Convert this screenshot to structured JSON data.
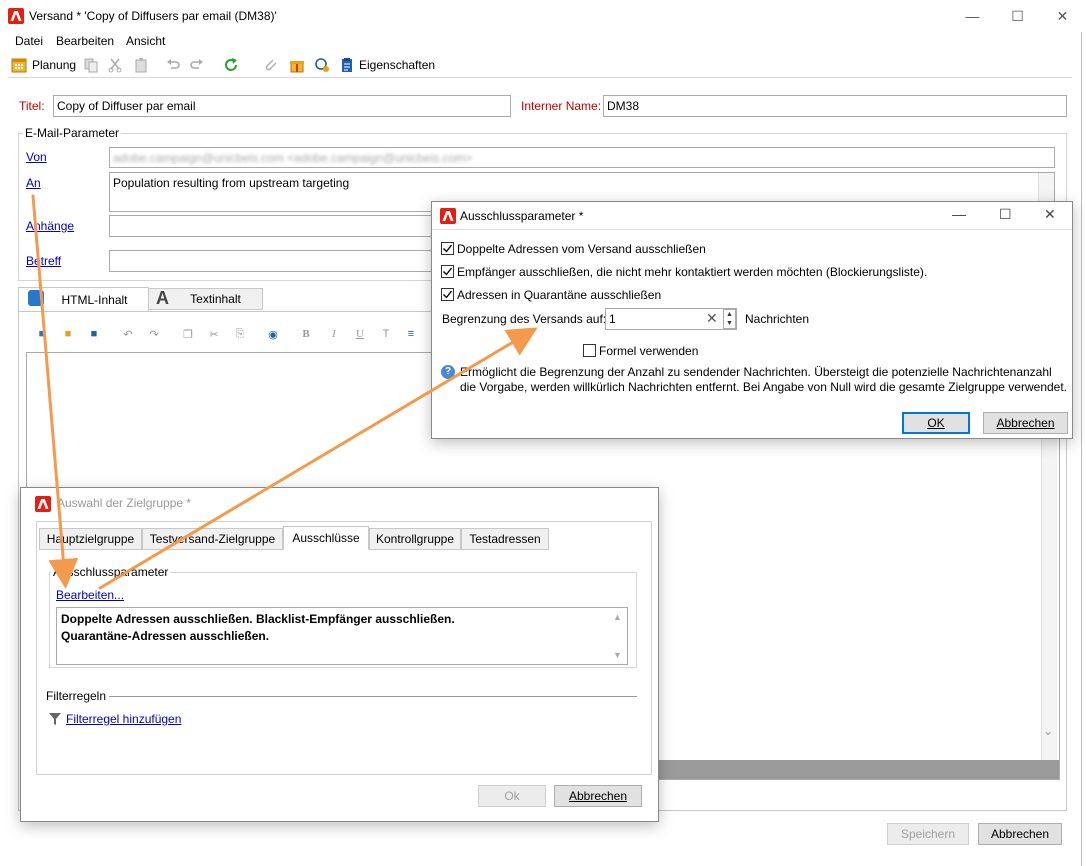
{
  "window": {
    "title": "Versand * 'Copy of Diffusers par email (DM38)'",
    "menu": [
      "Datei",
      "Bearbeiten",
      "Ansicht"
    ],
    "toolbar": {
      "planung": "Planung",
      "eigenschaften": "Eigenschaften"
    }
  },
  "form": {
    "titel_label": "Titel:",
    "titel_value": "Copy of Diffuser par email",
    "internal_label": "Interner Name:",
    "internal_value": "DM38",
    "email_params_title": "E-Mail-Parameter",
    "von_label": "Von",
    "von_value": "adobe.campaign@unicbeis.com <adobe.campaign@unicbeis.com>",
    "an_label": "An",
    "an_value": "Population resulting from upstream targeting",
    "anhaenge_label": "Anhänge",
    "betreff_label": "Betreff"
  },
  "content_tabs": {
    "html": "HTML-Inhalt",
    "text": "Textinhalt"
  },
  "editor_toolbar": {
    "bold": "B",
    "italic": "I",
    "underline": "U"
  },
  "main_buttons": {
    "save": "Speichern",
    "cancel": "Abbrechen"
  },
  "exclusion_dialog": {
    "title": "Ausschlussparameter *",
    "opt1": "Doppelte Adressen vom Versand ausschließen",
    "opt2": "Empfänger ausschließen, die nicht mehr kontaktiert werden möchten (Blockierungsliste).",
    "opt3": "Adressen in Quarantäne  ausschließen",
    "limit_label": "Begrenzung des Versands auf:",
    "limit_value": "1",
    "limit_unit": "Nachrichten",
    "formula_label": "Formel verwenden",
    "info_text": "Ermöglicht die Begrenzung der Anzahl zu sendender Nachrichten. Übersteigt die potenzielle Nachrichtenanzahl die Vorgabe, werden willkürlich Nachrichten entfernt. Bei Angabe von Null wird die gesamte Zielgruppe verwendet.",
    "ok": "OK",
    "cancel": "Abbrechen"
  },
  "target_dialog": {
    "title": "Auswahl der Zielgruppe *",
    "tabs": [
      "Hauptzielgruppe",
      "Testversand-Zielgruppe",
      "Ausschlüsse",
      "Kontrollgruppe",
      "Testadressen"
    ],
    "group_title": "Ausschlussparameter",
    "edit_link": "Bearbeiten...",
    "summary_line1": "Doppelte Adressen ausschließen. Blacklist-Empfänger ausschließen.",
    "summary_line2": "Quarantäne-Adressen ausschließen.",
    "filter_title": "Filterregeln",
    "filter_link": "Filterregel hinzufügen",
    "ok": "Ok",
    "cancel": "Abbrechen"
  },
  "colors": {
    "accent_red": "#c00000",
    "adobe_red": "#e41e13",
    "link": "#0000cc",
    "arrow": "#f39a4c"
  }
}
